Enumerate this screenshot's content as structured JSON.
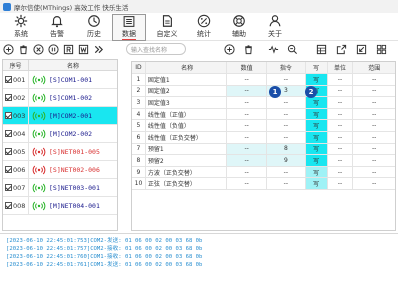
{
  "titlebar": {
    "text": "摩尔信使(MThings) 高效工作 快乐生活"
  },
  "nav": [
    {
      "label": "系统",
      "icon": "settings-gear-icon"
    },
    {
      "label": "告警",
      "icon": "bell-icon"
    },
    {
      "label": "历史",
      "icon": "history-clock-icon"
    },
    {
      "label": "数据",
      "icon": "data-list-icon",
      "active": true
    },
    {
      "label": "自定义",
      "icon": "custom-document-icon"
    },
    {
      "label": "统计",
      "icon": "percent-icon"
    },
    {
      "label": "辅助",
      "icon": "help-lifebuoy-icon"
    },
    {
      "label": "关于",
      "icon": "about-person-icon"
    }
  ],
  "device_list": {
    "headers": {
      "no": "序号",
      "name": "名称"
    },
    "rows": [
      {
        "no": "001",
        "name": "[S]COM1-001",
        "color": "#1a1a8c",
        "online": true
      },
      {
        "no": "002",
        "name": "[S]COM1-002",
        "color": "#1a1a8c",
        "online": true
      },
      {
        "no": "003",
        "name": "[M]COM2-001",
        "color": "#1a1a8c",
        "online": true,
        "selected": true
      },
      {
        "no": "004",
        "name": "[M]COM2-002",
        "color": "#1a1a8c",
        "online": true
      },
      {
        "no": "005",
        "name": "[S]NET001-005",
        "color": "#d83030",
        "online": false
      },
      {
        "no": "006",
        "name": "[S]NET002-006",
        "color": "#d83030",
        "online": false
      },
      {
        "no": "007",
        "name": "[S]NET003-001",
        "color": "#1a1a8c",
        "online": true
      },
      {
        "no": "008",
        "name": "[M]NET004-001",
        "color": "#1a1a8c",
        "online": true
      }
    ]
  },
  "search": {
    "placeholder": "输入查找名称"
  },
  "table": {
    "headers": {
      "id": "ID",
      "name": "名称",
      "value": "数值",
      "cmd": "指令",
      "w": "写",
      "unit": "单位",
      "range": "范围"
    },
    "rows": [
      {
        "id": "1",
        "name": "固定值1",
        "value": "--",
        "cmd": "--",
        "w": "写",
        "unit": "--",
        "range": "--"
      },
      {
        "id": "2",
        "name": "固定值2",
        "value": "--",
        "cmd": "3",
        "w": "写",
        "unit": "--",
        "range": "--"
      },
      {
        "id": "3",
        "name": "固定值3",
        "value": "--",
        "cmd": "--",
        "w": "写",
        "unit": "--",
        "range": "--"
      },
      {
        "id": "4",
        "name": "线性值（正值）",
        "value": "--",
        "cmd": "--",
        "w": "写",
        "unit": "--",
        "range": "--"
      },
      {
        "id": "5",
        "name": "线性值（负值）",
        "value": "--",
        "cmd": "--",
        "w": "写",
        "unit": "--",
        "range": "--"
      },
      {
        "id": "6",
        "name": "线性值（正负交替）",
        "value": "--",
        "cmd": "--",
        "w": "写",
        "unit": "--",
        "range": "--"
      },
      {
        "id": "7",
        "name": "预留1",
        "value": "--",
        "cmd": "8",
        "w": "写",
        "unit": "--",
        "range": "--"
      },
      {
        "id": "8",
        "name": "预留2",
        "value": "--",
        "cmd": "9",
        "w": "写",
        "unit": "--",
        "range": "--"
      },
      {
        "id": "9",
        "name": "方波（正负交替）",
        "value": "--",
        "cmd": "--",
        "w": "写",
        "unit": "--",
        "range": "--"
      },
      {
        "id": "10",
        "name": "正弦（正负交替）",
        "value": "--",
        "cmd": "--",
        "w": "写",
        "unit": "--",
        "range": "--"
      }
    ]
  },
  "badges": [
    "1",
    "2"
  ],
  "log": [
    "[2023-06-10 22:45:01:753]COM2-发送: 01 06 00 02 00 03 68 0b",
    "[2023-06-10 22:45:01:757]COM2-接收: 01 06 00 02 00 03 68 0b",
    "[2023-06-10 22:45:01:760]COM1-接收: 01 06 00 02 00 03 68 0b",
    "[2023-06-10 22:45:01:761]COM1-发送: 01 06 00 02 00 03 68 0b"
  ]
}
